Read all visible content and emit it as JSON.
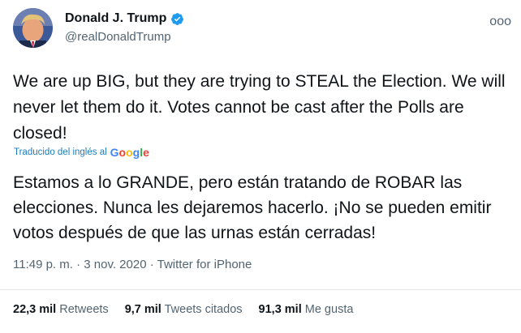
{
  "author": {
    "name": "Donald J. Trump",
    "handle": "@realDonaldTrump"
  },
  "tweet": {
    "text": "We are up BIG, but they are trying to STEAL the Election. We will never let them do it. Votes cannot be cast after the Polls are closed!",
    "translated_label": "Traducido del inglés al",
    "translation_provider": [
      "G",
      "o",
      "o",
      "g",
      "l",
      "e"
    ],
    "translation": "Estamos a lo GRANDE, pero están tratando de ROBAR las elecciones. Nunca les dejaremos hacerlo. ¡No se pueden emitir votos después de que las urnas están cerradas!",
    "timestamp": "11:49 p. m. · 3 nov. 2020",
    "separator": "·",
    "source": "Twitter for iPhone"
  },
  "stats": {
    "retweets_count": "22,3 mil",
    "retweets_label": "Retweets",
    "quotes_count": "9,7 mil",
    "quotes_label": "Tweets citados",
    "likes_count": "91,3 mil",
    "likes_label": "Me gusta"
  },
  "menu": {
    "more_label": "ooo"
  },
  "colors": {
    "verified": "#1d9bf0",
    "link": "#1d7db8",
    "secondary_text": "#536471"
  },
  "icons": [
    "verified-badge-icon",
    "more-options-icon",
    "google-logo"
  ]
}
